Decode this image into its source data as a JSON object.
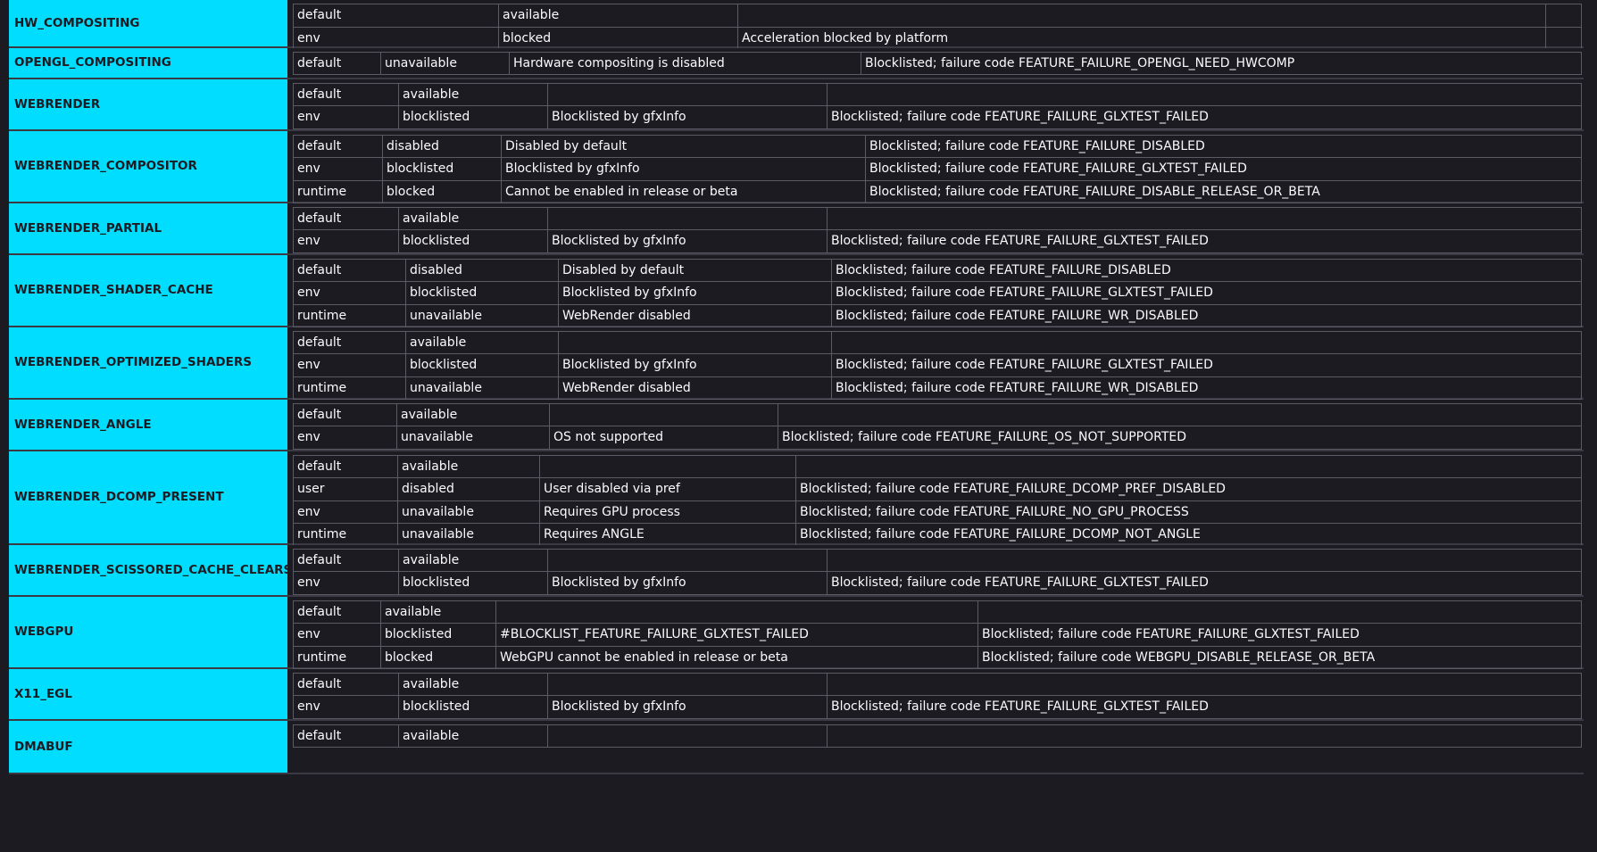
{
  "features": [
    {
      "name": "HW_COMPOSITING",
      "cols": [
        230,
        268,
        905,
        40
      ],
      "rows": [
        [
          "default",
          "available",
          "",
          ""
        ],
        [
          "env",
          "blocked",
          "Acceleration blocked by platform",
          ""
        ]
      ]
    },
    {
      "name": "OPENGL_COMPOSITING",
      "cols": [
        98,
        144,
        394,
        807
      ],
      "rows": [
        [
          "default",
          "unavailable",
          "Hardware compositing is disabled",
          "Blocklisted; failure code FEATURE_FAILURE_OPENGL_NEED_HWCOMP"
        ]
      ]
    },
    {
      "name": "WEBRENDER",
      "cols": [
        118,
        167,
        313,
        845
      ],
      "rows": [
        [
          "default",
          "available",
          "",
          ""
        ],
        [
          "env",
          "blocklisted",
          "Blocklisted by gfxInfo",
          "Blocklisted; failure code FEATURE_FAILURE_GLXTEST_FAILED"
        ]
      ]
    },
    {
      "name": "WEBRENDER_COMPOSITOR",
      "cols": [
        100,
        133,
        408,
        802
      ],
      "rows": [
        [
          "default",
          "disabled",
          "Disabled by default",
          "Blocklisted; failure code FEATURE_FAILURE_DISABLED"
        ],
        [
          "env",
          "blocklisted",
          "Blocklisted by gfxInfo",
          "Blocklisted; failure code FEATURE_FAILURE_GLXTEST_FAILED"
        ],
        [
          "runtime",
          "blocked",
          "Cannot be enabled in release or beta",
          "Blocklisted; failure code FEATURE_FAILURE_DISABLE_RELEASE_OR_BETA"
        ]
      ]
    },
    {
      "name": "WEBRENDER_PARTIAL",
      "cols": [
        118,
        167,
        313,
        845
      ],
      "rows": [
        [
          "default",
          "available",
          "",
          ""
        ],
        [
          "env",
          "blocklisted",
          "Blocklisted by gfxInfo",
          "Blocklisted; failure code FEATURE_FAILURE_GLXTEST_FAILED"
        ]
      ]
    },
    {
      "name": "WEBRENDER_SHADER_CACHE",
      "cols": [
        126,
        171,
        306,
        840
      ],
      "rows": [
        [
          "default",
          "disabled",
          "Disabled by default",
          "Blocklisted; failure code FEATURE_FAILURE_DISABLED"
        ],
        [
          "env",
          "blocklisted",
          "Blocklisted by gfxInfo",
          "Blocklisted; failure code FEATURE_FAILURE_GLXTEST_FAILED"
        ],
        [
          "runtime",
          "unavailable",
          "WebRender disabled",
          "Blocklisted; failure code FEATURE_FAILURE_WR_DISABLED"
        ]
      ]
    },
    {
      "name": "WEBRENDER_OPTIMIZED_SHADERS",
      "cols": [
        126,
        171,
        306,
        840
      ],
      "rows": [
        [
          "default",
          "available",
          "",
          ""
        ],
        [
          "env",
          "blocklisted",
          "Blocklisted by gfxInfo",
          "Blocklisted; failure code FEATURE_FAILURE_GLXTEST_FAILED"
        ],
        [
          "runtime",
          "unavailable",
          "WebRender disabled",
          "Blocklisted; failure code FEATURE_FAILURE_WR_DISABLED"
        ]
      ]
    },
    {
      "name": "WEBRENDER_ANGLE",
      "cols": [
        116,
        171,
        256,
        900
      ],
      "rows": [
        [
          "default",
          "available",
          "",
          ""
        ],
        [
          "env",
          "unavailable",
          "OS not supported",
          "Blocklisted; failure code FEATURE_FAILURE_OS_NOT_SUPPORTED"
        ]
      ]
    },
    {
      "name": "WEBRENDER_DCOMP_PRESENT",
      "cols": [
        117,
        159,
        287,
        880
      ],
      "rows": [
        [
          "default",
          "available",
          "",
          ""
        ],
        [
          "user",
          "disabled",
          "User disabled via pref",
          "Blocklisted; failure code FEATURE_FAILURE_DCOMP_PREF_DISABLED"
        ],
        [
          "env",
          "unavailable",
          "Requires GPU process",
          "Blocklisted; failure code FEATURE_FAILURE_NO_GPU_PROCESS"
        ],
        [
          "runtime",
          "unavailable",
          "Requires ANGLE",
          "Blocklisted; failure code FEATURE_FAILURE_DCOMP_NOT_ANGLE"
        ]
      ]
    },
    {
      "name": "WEBRENDER_SCISSORED_CACHE_CLEARS",
      "cols": [
        118,
        167,
        313,
        845
      ],
      "rows": [
        [
          "default",
          "available",
          "",
          ""
        ],
        [
          "env",
          "blocklisted",
          "Blocklisted by gfxInfo",
          "Blocklisted; failure code FEATURE_FAILURE_GLXTEST_FAILED"
        ]
      ]
    },
    {
      "name": "WEBGPU",
      "cols": [
        98,
        129,
        540,
        676
      ],
      "rows": [
        [
          "default",
          "available",
          "",
          ""
        ],
        [
          "env",
          "blocklisted",
          "#BLOCKLIST_FEATURE_FAILURE_GLXTEST_FAILED",
          "Blocklisted; failure code FEATURE_FAILURE_GLXTEST_FAILED"
        ],
        [
          "runtime",
          "blocked",
          "WebGPU cannot be enabled in release or beta",
          "Blocklisted; failure code WEBGPU_DISABLE_RELEASE_OR_BETA"
        ]
      ]
    },
    {
      "name": "X11_EGL",
      "cols": [
        118,
        167,
        313,
        845
      ],
      "rows": [
        [
          "default",
          "available",
          "",
          ""
        ],
        [
          "env",
          "blocklisted",
          "Blocklisted by gfxInfo",
          "Blocklisted; failure code FEATURE_FAILURE_GLXTEST_FAILED"
        ]
      ]
    },
    {
      "name": "DMABUF",
      "cols": [
        118,
        167,
        313,
        845
      ],
      "rows": [
        [
          "default",
          "available",
          "",
          ""
        ]
      ]
    }
  ]
}
